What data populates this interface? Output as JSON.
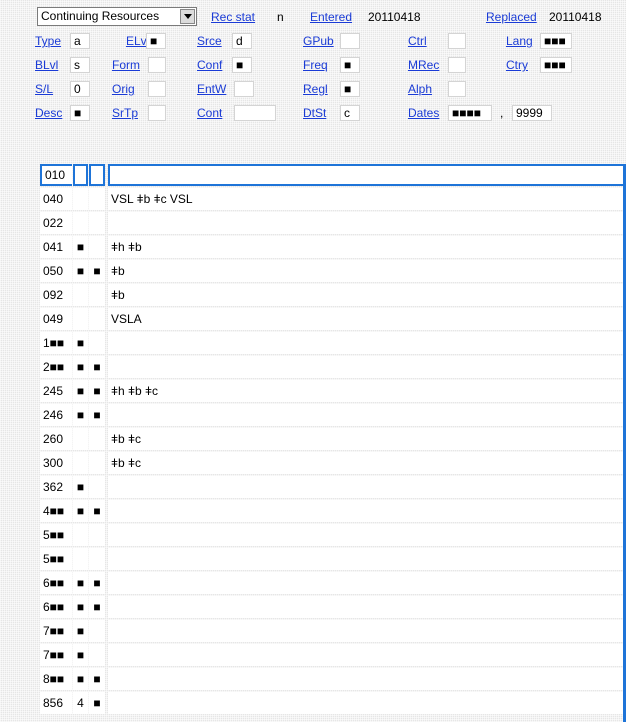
{
  "header": {
    "type_select": {
      "value": "Continuing Resources"
    },
    "rec_stat": {
      "label": "Rec stat",
      "value": "n"
    },
    "entered": {
      "label": "Entered",
      "value": "20110418"
    },
    "replaced": {
      "label": "Replaced",
      "value": "20110418"
    }
  },
  "fixed_fields": {
    "type": {
      "label": "Type",
      "value": "a"
    },
    "elvl": {
      "label": "ELvl",
      "value": "■"
    },
    "srce": {
      "label": "Srce",
      "value": "d"
    },
    "gpub": {
      "label": "GPub",
      "value": ""
    },
    "ctrl": {
      "label": "Ctrl",
      "value": ""
    },
    "lang": {
      "label": "Lang",
      "value": "■■■"
    },
    "blvl": {
      "label": "BLvl",
      "value": "s"
    },
    "form": {
      "label": "Form",
      "value": ""
    },
    "conf": {
      "label": "Conf",
      "value": "■"
    },
    "freq": {
      "label": "Freq",
      "value": "■"
    },
    "mrec": {
      "label": "MRec",
      "value": ""
    },
    "ctry": {
      "label": "Ctry",
      "value": "■■■"
    },
    "sl": {
      "label": "S/L",
      "value": "0"
    },
    "orig": {
      "label": "Orig",
      "value": ""
    },
    "entw": {
      "label": "EntW",
      "value": ""
    },
    "regl": {
      "label": "Regl",
      "value": "■"
    },
    "alph": {
      "label": "Alph",
      "value": ""
    },
    "desc": {
      "label": "Desc",
      "value": "■"
    },
    "srtp": {
      "label": "SrTp",
      "value": ""
    },
    "cont": {
      "label": "Cont",
      "value": ""
    },
    "dtst": {
      "label": "DtSt",
      "value": "c"
    },
    "dates": {
      "label": "Dates",
      "value1": "■■■■",
      "separator": ",",
      "value2": "9999"
    }
  },
  "marc_rows": [
    {
      "tag": "010",
      "ind1": "",
      "ind2": "",
      "text": ""
    },
    {
      "tag": "040",
      "ind1": "",
      "ind2": "",
      "text": "VSL ǂb ǂc VSL"
    },
    {
      "tag": "022",
      "ind1": "",
      "ind2": "",
      "text": ""
    },
    {
      "tag": "041",
      "ind1": "■",
      "ind2": "",
      "text": " ǂh ǂb"
    },
    {
      "tag": "050",
      "ind1": "■",
      "ind2": "■",
      "text": " ǂb"
    },
    {
      "tag": "092",
      "ind1": "",
      "ind2": "",
      "text": " ǂb"
    },
    {
      "tag": "049",
      "ind1": "",
      "ind2": "",
      "text": "VSLA"
    },
    {
      "tag": "1■■",
      "ind1": "■",
      "ind2": "",
      "text": ""
    },
    {
      "tag": "2■■",
      "ind1": "■",
      "ind2": "■",
      "text": ""
    },
    {
      "tag": "245",
      "ind1": "■",
      "ind2": "■",
      "text": " ǂh ǂb ǂc"
    },
    {
      "tag": "246",
      "ind1": "■",
      "ind2": "■",
      "text": ""
    },
    {
      "tag": "260",
      "ind1": "",
      "ind2": "",
      "text": " ǂb ǂc"
    },
    {
      "tag": "300",
      "ind1": "",
      "ind2": "",
      "text": " ǂb ǂc"
    },
    {
      "tag": "362",
      "ind1": "■",
      "ind2": "",
      "text": ""
    },
    {
      "tag": "4■■",
      "ind1": "■",
      "ind2": "■",
      "text": ""
    },
    {
      "tag": "5■■",
      "ind1": "",
      "ind2": "",
      "text": ""
    },
    {
      "tag": "5■■",
      "ind1": "",
      "ind2": "",
      "text": ""
    },
    {
      "tag": "6■■",
      "ind1": "■",
      "ind2": "■",
      "text": ""
    },
    {
      "tag": "6■■",
      "ind1": "■",
      "ind2": "■",
      "text": ""
    },
    {
      "tag": "7■■",
      "ind1": "■",
      "ind2": "",
      "text": ""
    },
    {
      "tag": "7■■",
      "ind1": "■",
      "ind2": "",
      "text": ""
    },
    {
      "tag": "8■■",
      "ind1": "■",
      "ind2": "■",
      "text": ""
    },
    {
      "tag": "856",
      "ind1": "4",
      "ind2": "■",
      "text": ""
    }
  ],
  "colors": {
    "link": "#1a3bd6",
    "selection": "#1e74d8"
  }
}
